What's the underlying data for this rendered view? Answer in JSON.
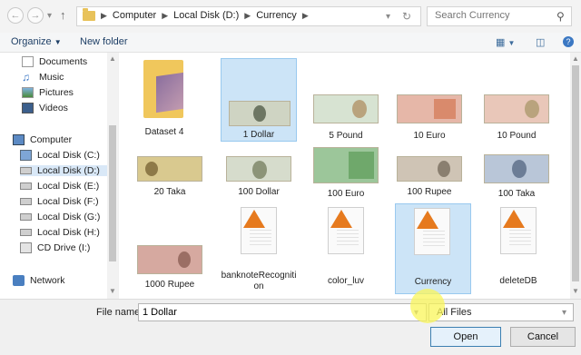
{
  "address": {
    "crumbs": [
      "Computer",
      "Local Disk (D:)",
      "Currency"
    ],
    "search_placeholder": "Search Currency"
  },
  "toolbar": {
    "organize": "Organize",
    "new_folder": "New folder"
  },
  "nav": {
    "libraries": [
      "Documents",
      "Music",
      "Pictures",
      "Videos"
    ],
    "computer": "Computer",
    "drives": [
      "Local Disk (C:)",
      "Local Disk (D:)",
      "Local Disk (E:)",
      "Local Disk (F:)",
      "Local Disk (G:)",
      "Local Disk (H:)",
      "CD Drive (I:)"
    ],
    "network": "Network"
  },
  "items": [
    {
      "name": "Dataset 4",
      "kind": "folder"
    },
    {
      "name": "1 Dollar",
      "kind": "image",
      "selected": true
    },
    {
      "name": "5 Pound",
      "kind": "image"
    },
    {
      "name": "10 Euro",
      "kind": "image"
    },
    {
      "name": "10 Pound",
      "kind": "image"
    },
    {
      "name": "20 Taka",
      "kind": "image"
    },
    {
      "name": "100 Dollar",
      "kind": "image"
    },
    {
      "name": "100 Euro",
      "kind": "image"
    },
    {
      "name": "100 Rupee",
      "kind": "image"
    },
    {
      "name": "100 Taka",
      "kind": "image"
    },
    {
      "name": "1000 Rupee",
      "kind": "image"
    },
    {
      "name": "banknoteRecognition",
      "kind": "matlab-file"
    },
    {
      "name": "color_luv",
      "kind": "matlab-file"
    },
    {
      "name": "Currency",
      "kind": "matlab-file",
      "selected": true
    },
    {
      "name": "deleteDB",
      "kind": "matlab-file"
    }
  ],
  "bottom": {
    "file_name_label": "File name:",
    "file_name_value": "1 Dollar",
    "filter_value": "All Files",
    "open": "Open",
    "cancel": "Cancel"
  }
}
